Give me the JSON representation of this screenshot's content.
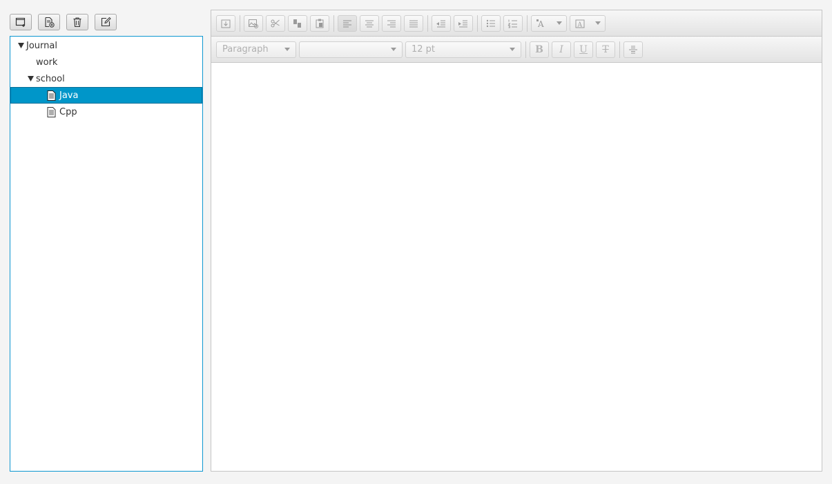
{
  "left_toolbar": {
    "buttons": [
      {
        "icon": "new-folder-icon"
      },
      {
        "icon": "new-file-icon"
      },
      {
        "icon": "trash-icon"
      },
      {
        "icon": "edit-icon"
      }
    ]
  },
  "tree": {
    "items": [
      {
        "label": "Journal",
        "level": 0,
        "expanded": true,
        "type": "folder"
      },
      {
        "label": "work",
        "level": 1,
        "type": "folder"
      },
      {
        "label": "school",
        "level": 1,
        "expanded": true,
        "type": "folder"
      },
      {
        "label": "Java",
        "level": 2,
        "type": "file",
        "selected": true
      },
      {
        "label": "Cpp",
        "level": 2,
        "type": "file"
      }
    ]
  },
  "editor": {
    "format_combo": "Paragraph",
    "font_combo": "",
    "size_combo": "12 pt",
    "bold_label": "B",
    "italic_label": "I",
    "underline_label": "U",
    "strike_label": "T"
  },
  "colors": {
    "selection": "#0096c9",
    "tree_border": "#0b96d1"
  }
}
